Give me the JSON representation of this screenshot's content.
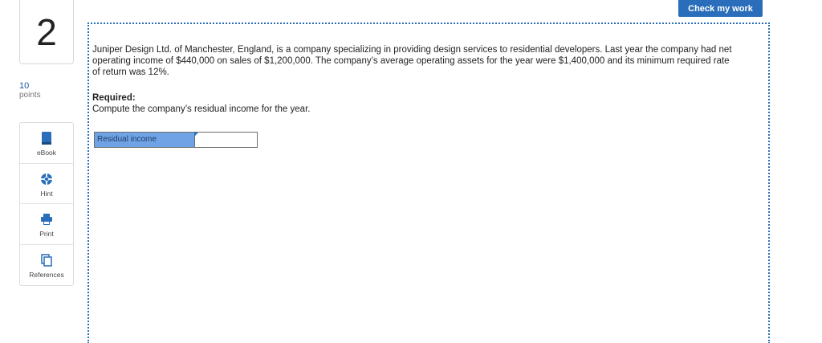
{
  "question": {
    "number": "2",
    "points_value": "10",
    "points_label": "points"
  },
  "tools": [
    {
      "label": "eBook",
      "icon": "book-icon"
    },
    {
      "label": "Hint",
      "icon": "lifebuoy-icon"
    },
    {
      "label": "Print",
      "icon": "printer-icon"
    },
    {
      "label": "References",
      "icon": "copy-icon"
    }
  ],
  "header": {
    "check_label": "Check my work"
  },
  "problem": {
    "text": "Juniper Design Ltd. of Manchester, England, is a company specializing in providing design services to residential developers. Last year the company had net operating income of $440,000 on sales of $1,200,000. The company’s average operating assets for the year were $1,400,000 and its minimum required rate of return was 12%.",
    "required_heading": "Required:",
    "required_text": "Compute the company’s residual income for the year."
  },
  "answer": {
    "label": "Residual income",
    "value": ""
  },
  "colors": {
    "accent": "#2a6ebb",
    "label_fill": "#6fa3e6"
  }
}
